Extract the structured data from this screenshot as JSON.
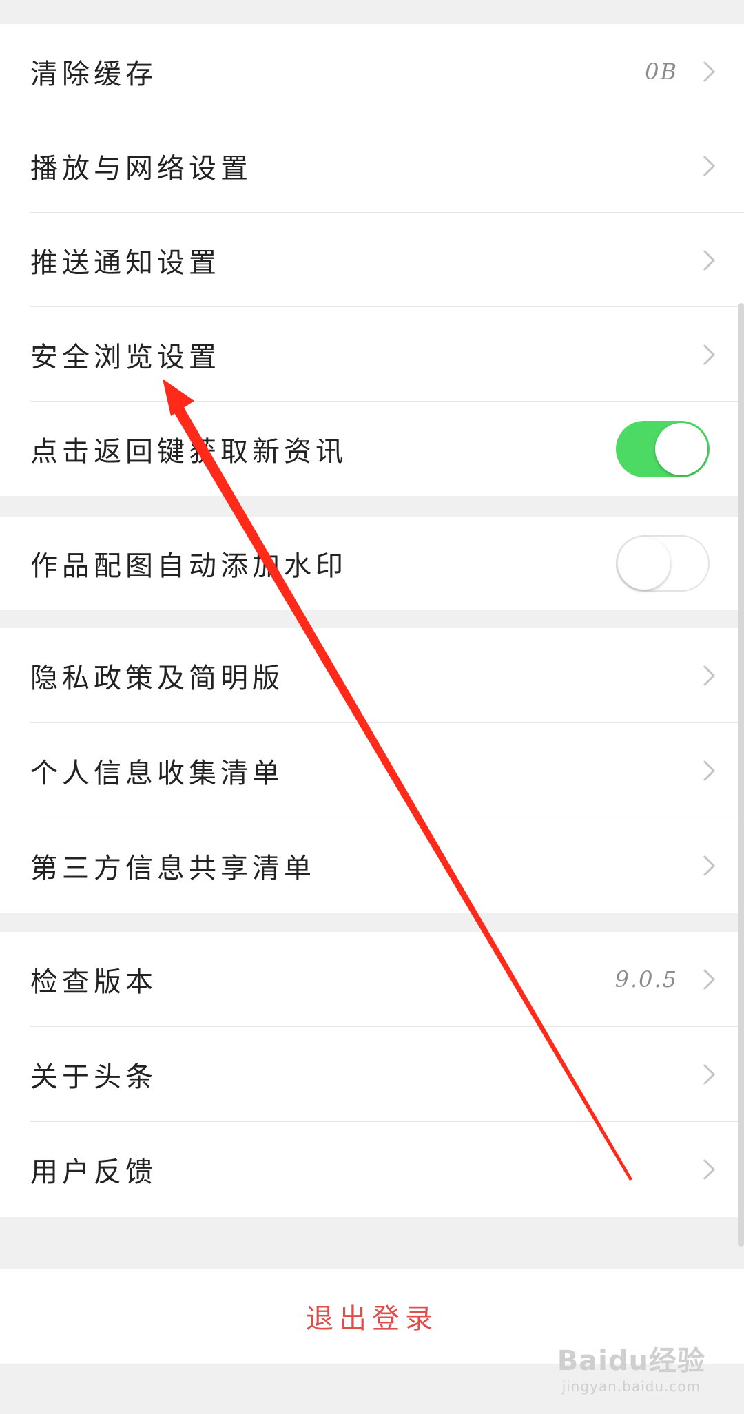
{
  "settings": {
    "group1": [
      {
        "label": "清除缓存",
        "value": "0B",
        "type": "chevron"
      },
      {
        "label": "播放与网络设置",
        "type": "chevron"
      },
      {
        "label": "推送通知设置",
        "type": "chevron"
      },
      {
        "label": "安全浏览设置",
        "type": "chevron"
      },
      {
        "label": "点击返回键获取新资讯",
        "type": "toggle",
        "state": "on"
      }
    ],
    "group2": [
      {
        "label": "作品配图自动添加水印",
        "type": "toggle",
        "state": "off"
      }
    ],
    "group3": [
      {
        "label": "隐私政策及简明版",
        "type": "chevron"
      },
      {
        "label": "个人信息收集清单",
        "type": "chevron"
      },
      {
        "label": "第三方信息共享清单",
        "type": "chevron"
      }
    ],
    "group4": [
      {
        "label": "检查版本",
        "value": "9.0.5",
        "type": "chevron"
      },
      {
        "label": "关于头条",
        "type": "chevron"
      },
      {
        "label": "用户反馈",
        "type": "chevron"
      }
    ]
  },
  "logout_label": "退出登录",
  "watermark": {
    "main": "Baidu经验",
    "sub": "jingyan.baidu.com"
  },
  "colors": {
    "toggle_on": "#4cd964",
    "logout_text": "#e04d4d",
    "annotation_arrow": "#ff2a1a"
  }
}
